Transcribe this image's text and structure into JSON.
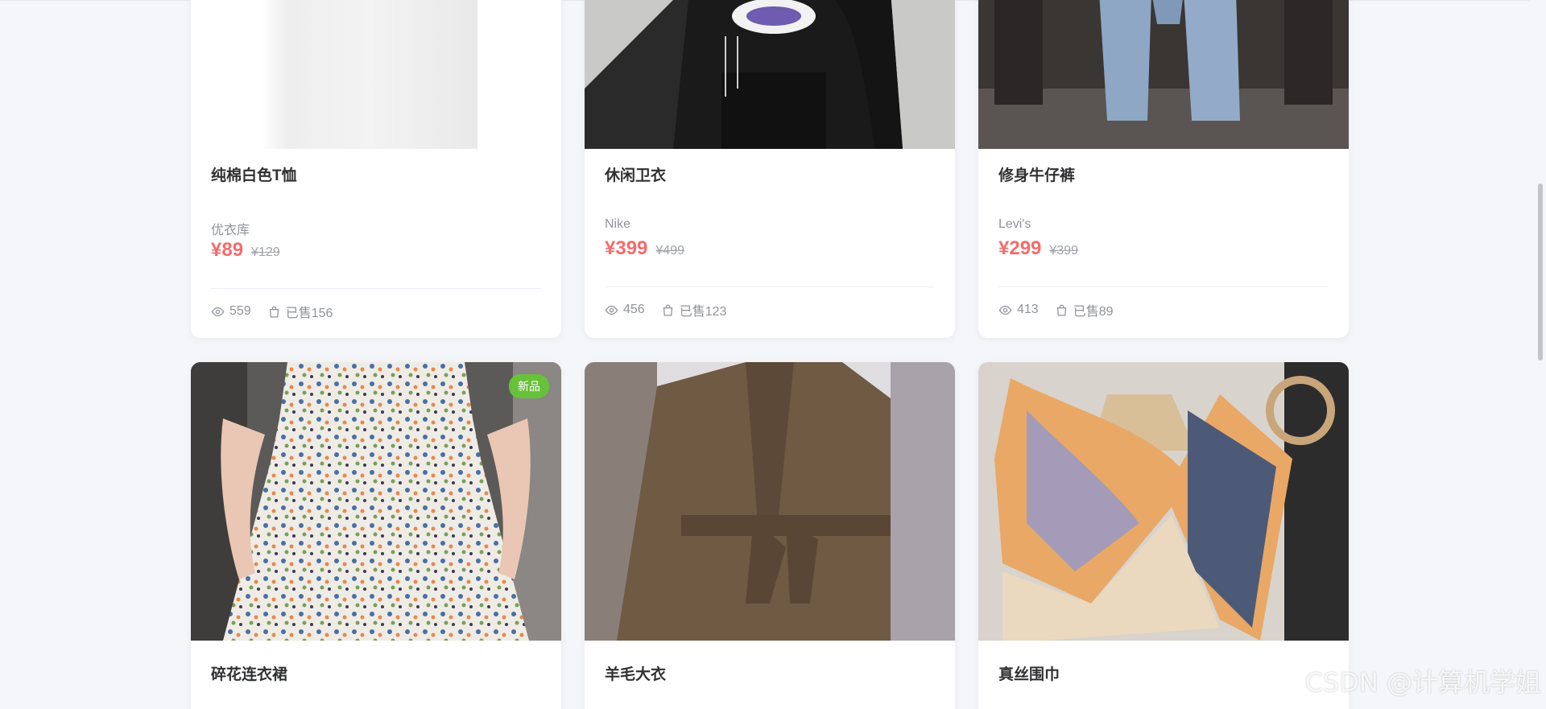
{
  "products": [
    {
      "name": "纯棉白色T恤",
      "brand": "优衣库",
      "price": "¥89",
      "original_price": "¥129",
      "views": "559",
      "sold": "已售156",
      "image": "white-tshirt-photo"
    },
    {
      "name": "休闲卫衣",
      "brand": "Nike",
      "price": "¥399",
      "original_price": "¥499",
      "views": "456",
      "sold": "已售123",
      "image": "black-hoodie-photo"
    },
    {
      "name": "修身牛仔裤",
      "brand": "Levi's",
      "price": "¥299",
      "original_price": "¥399",
      "views": "413",
      "sold": "已售89",
      "image": "blue-jeans-photo"
    },
    {
      "name": "碎花连衣裙",
      "badge": "新品",
      "image": "floral-dress-photo"
    },
    {
      "name": "羊毛大衣",
      "image": "wool-coat-photo"
    },
    {
      "name": "真丝围巾",
      "image": "silk-scarf-photo"
    }
  ],
  "icons": {
    "views": "eye-icon",
    "sold": "shopping-bag-icon"
  },
  "colors": {
    "price": "#f56c6c",
    "badge": "#67c23a",
    "background": "#f5f6f9"
  },
  "watermark": "CSDN @计算机学姐"
}
